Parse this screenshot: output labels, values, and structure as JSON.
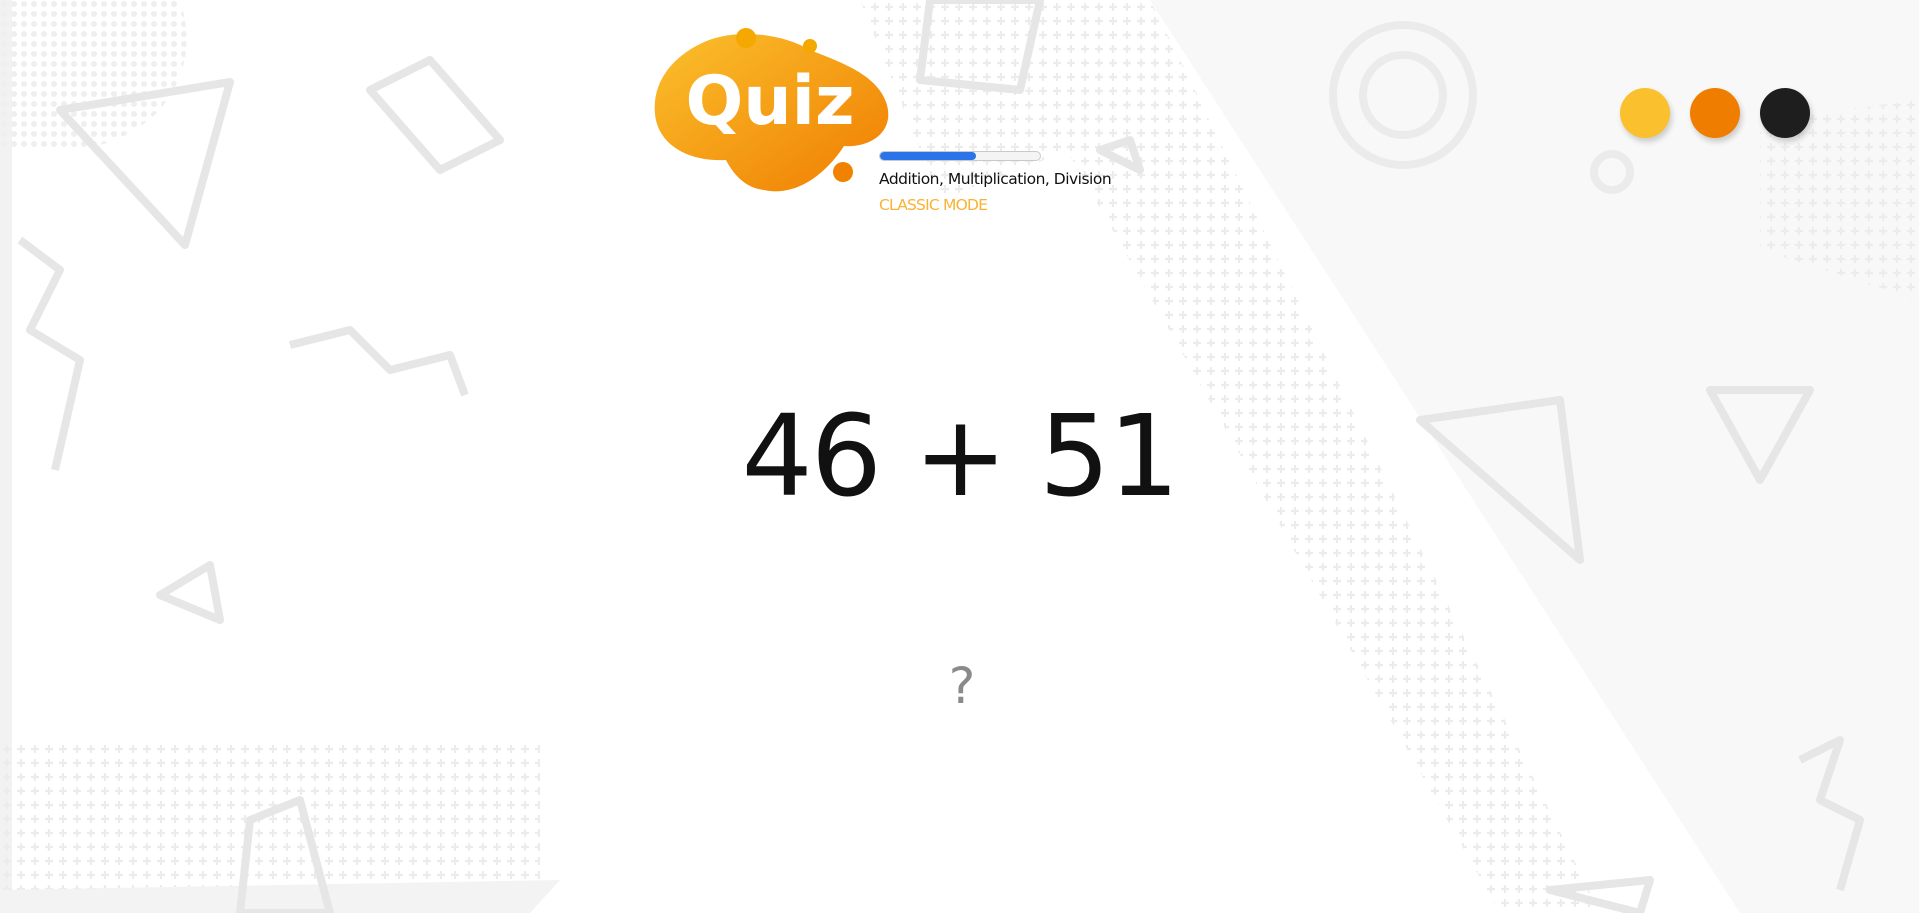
{
  "app": {
    "logo_text": "Quiz",
    "subtitle": "Addition, Multiplication, Division",
    "mode": "CLASSIC MODE",
    "progress_fraction": 0.6
  },
  "theme": {
    "options": [
      {
        "name": "yellow",
        "color": "#FBC02D"
      },
      {
        "name": "orange",
        "color": "#EF7D00"
      },
      {
        "name": "black",
        "color": "#1E1E1E"
      }
    ]
  },
  "colors": {
    "accent_yellow": "#FBC02D",
    "accent_orange": "#EF7D00",
    "progress_blue": "#2A73E8",
    "mode_label": "#F9B233"
  },
  "question": {
    "operand_a": 46,
    "operator": "+",
    "operand_b": 51,
    "text": "46 + 51"
  },
  "answer": {
    "value": "",
    "placeholder": "?"
  }
}
